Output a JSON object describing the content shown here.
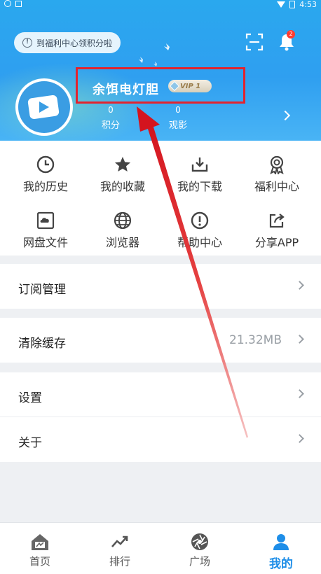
{
  "status_bar": {
    "time": "4:53"
  },
  "header": {
    "reward_text": "到福利中心领积分啦",
    "notification_count": "2",
    "username": "余饵电灯胆",
    "vip_label": "VIP 1",
    "stats": [
      {
        "value": "0",
        "label": "积分"
      },
      {
        "value": "0",
        "label": "观影"
      }
    ]
  },
  "grid": {
    "items": [
      {
        "label": "我的历史",
        "icon": "history-clock-icon"
      },
      {
        "label": "我的收藏",
        "icon": "star-icon"
      },
      {
        "label": "我的下载",
        "icon": "download-icon"
      },
      {
        "label": "福利中心",
        "icon": "award-icon"
      },
      {
        "label": "网盘文件",
        "icon": "cloud-drive-icon"
      },
      {
        "label": "浏览器",
        "icon": "globe-icon"
      },
      {
        "label": "帮助中心",
        "icon": "help-icon"
      },
      {
        "label": "分享APP",
        "icon": "share-icon"
      }
    ]
  },
  "list": {
    "subscription": {
      "label": "订阅管理"
    },
    "cache": {
      "label": "清除缓存",
      "value": "21.32MB"
    },
    "settings": {
      "label": "设置"
    },
    "about": {
      "label": "关于"
    }
  },
  "bottom_nav": {
    "items": [
      {
        "label": "首页",
        "icon": "home-icon"
      },
      {
        "label": "排行",
        "icon": "trend-icon"
      },
      {
        "label": "广场",
        "icon": "aperture-icon"
      },
      {
        "label": "我的",
        "icon": "person-icon",
        "active": true
      }
    ]
  },
  "colors": {
    "accent": "#1e8ee8",
    "header": "#2fa3ef",
    "annotation": "#e3232e"
  }
}
